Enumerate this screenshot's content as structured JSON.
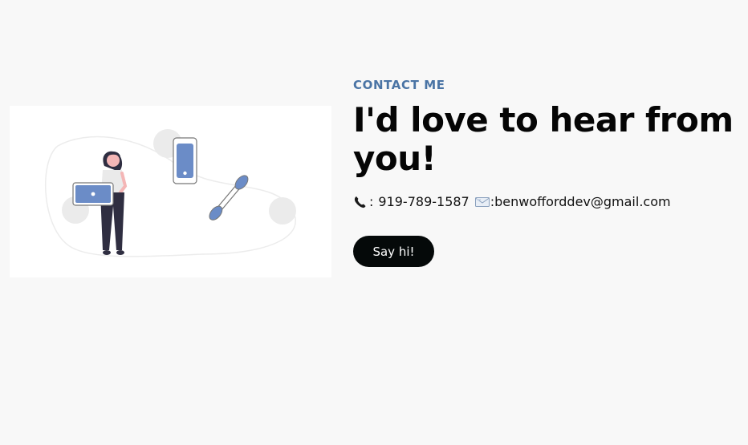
{
  "contact": {
    "eyebrow": "CONTACT ME",
    "headline": "I'd love to hear from you!",
    "phone_separator": ":",
    "phone": "919-789-1587",
    "email_separator": ":",
    "email": "benwofforddev@gmail.com",
    "cta_label": "Say hi!"
  },
  "icons": {
    "phone": "telephone-receiver-icon",
    "email": "envelope-icon"
  },
  "colors": {
    "background": "#f8f8f8",
    "accent": "#4a74a5",
    "headline": "#050505",
    "button_bg": "#050909",
    "button_text": "#ffffff",
    "illustration_blue": "#6b8cc7"
  }
}
